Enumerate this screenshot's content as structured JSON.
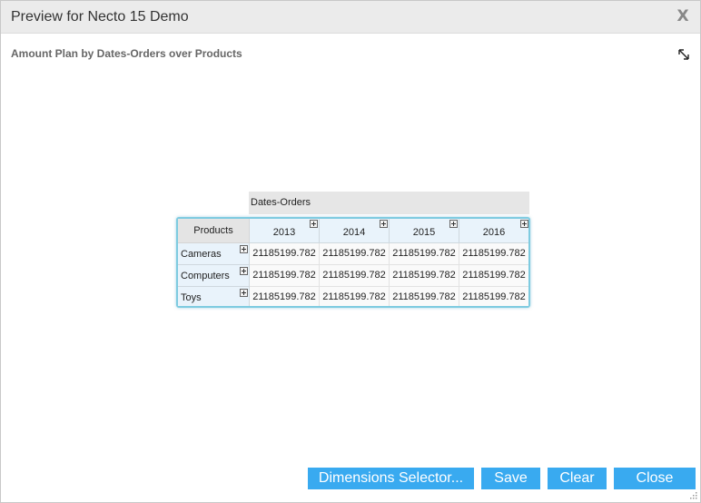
{
  "window": {
    "title": "Preview for Necto 15 Demo",
    "close_glyph": "X"
  },
  "report": {
    "title": "Amount Plan by Dates-Orders over Products",
    "expand_icon": "expand-icon"
  },
  "pivot": {
    "column_dimension": "Dates-Orders",
    "row_dimension": "Products",
    "columns": [
      "2013",
      "2014",
      "2015",
      "2016"
    ],
    "rows": [
      {
        "label": "Cameras",
        "values": [
          "21185199.782",
          "21185199.782",
          "21185199.782",
          "21185199.782"
        ]
      },
      {
        "label": "Computers",
        "values": [
          "21185199.782",
          "21185199.782",
          "21185199.782",
          "21185199.782"
        ]
      },
      {
        "label": "Toys",
        "values": [
          "21185199.782",
          "21185199.782",
          "21185199.782",
          "21185199.782"
        ]
      }
    ]
  },
  "buttons": {
    "dimensions_selector": "Dimensions Selector...",
    "save": "Save",
    "clear": "Clear",
    "close": "Close"
  },
  "colors": {
    "accent": "#39aaf0",
    "pivot_border": "#7ecbe0"
  }
}
